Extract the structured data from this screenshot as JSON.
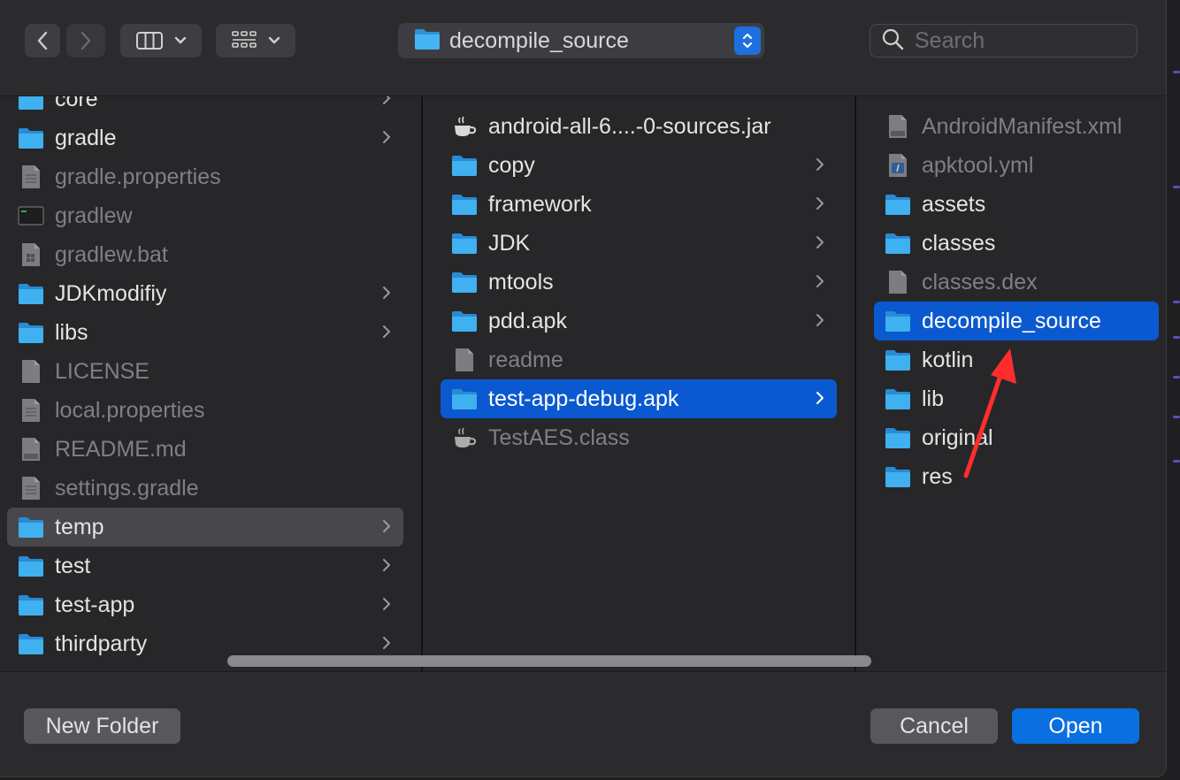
{
  "toolbar": {
    "back_icon": "chevron-left-icon",
    "forward_icon": "chevron-right-icon",
    "view_mode_icon": "columns-view-icon",
    "group_icon": "grid-view-icon",
    "path_label": "decompile_source",
    "search_placeholder": "Search"
  },
  "columns": [
    {
      "items": [
        {
          "label": "core",
          "kind": "folder",
          "dim": false,
          "chevron": true,
          "selected": ""
        },
        {
          "label": "gradle",
          "kind": "folder",
          "dim": false,
          "chevron": true,
          "selected": ""
        },
        {
          "label": "gradle.properties",
          "kind": "doc",
          "dim": true,
          "chevron": false,
          "selected": ""
        },
        {
          "label": "gradlew",
          "kind": "exec",
          "dim": true,
          "chevron": false,
          "selected": ""
        },
        {
          "label": "gradlew.bat",
          "kind": "bat",
          "dim": true,
          "chevron": false,
          "selected": ""
        },
        {
          "label": "JDKmodifiy",
          "kind": "folder",
          "dim": false,
          "chevron": true,
          "selected": ""
        },
        {
          "label": "libs",
          "kind": "folder",
          "dim": false,
          "chevron": true,
          "selected": ""
        },
        {
          "label": "LICENSE",
          "kind": "blank",
          "dim": true,
          "chevron": false,
          "selected": ""
        },
        {
          "label": "local.properties",
          "kind": "doc",
          "dim": true,
          "chevron": false,
          "selected": ""
        },
        {
          "label": "README.md",
          "kind": "md",
          "dim": true,
          "chevron": false,
          "selected": ""
        },
        {
          "label": "settings.gradle",
          "kind": "doc",
          "dim": true,
          "chevron": false,
          "selected": ""
        },
        {
          "label": "temp",
          "kind": "folder",
          "dim": false,
          "chevron": true,
          "selected": "gray"
        },
        {
          "label": "test",
          "kind": "folder",
          "dim": false,
          "chevron": true,
          "selected": ""
        },
        {
          "label": "test-app",
          "kind": "folder",
          "dim": false,
          "chevron": true,
          "selected": ""
        },
        {
          "label": "thirdparty",
          "kind": "folder",
          "dim": false,
          "chevron": true,
          "selected": ""
        }
      ]
    },
    {
      "items": [
        {
          "label": "android-all-6....-0-sources.jar",
          "kind": "jar",
          "dim": false,
          "chevron": false,
          "selected": ""
        },
        {
          "label": "copy",
          "kind": "folder",
          "dim": false,
          "chevron": true,
          "selected": ""
        },
        {
          "label": "framework",
          "kind": "folder",
          "dim": false,
          "chevron": true,
          "selected": ""
        },
        {
          "label": "JDK",
          "kind": "folder",
          "dim": false,
          "chevron": true,
          "selected": ""
        },
        {
          "label": "mtools",
          "kind": "folder",
          "dim": false,
          "chevron": true,
          "selected": ""
        },
        {
          "label": "pdd.apk",
          "kind": "folder",
          "dim": false,
          "chevron": true,
          "selected": ""
        },
        {
          "label": "readme",
          "kind": "blank",
          "dim": true,
          "chevron": false,
          "selected": ""
        },
        {
          "label": "test-app-debug.apk",
          "kind": "folder",
          "dim": false,
          "chevron": true,
          "selected": "blue"
        },
        {
          "label": "TestAES.class",
          "kind": "jar",
          "dim": true,
          "chevron": false,
          "selected": ""
        }
      ]
    },
    {
      "items": [
        {
          "label": "AndroidManifest.xml",
          "kind": "xml",
          "dim": true,
          "chevron": false,
          "selected": ""
        },
        {
          "label": "apktool.yml",
          "kind": "yml",
          "dim": true,
          "chevron": false,
          "selected": ""
        },
        {
          "label": "assets",
          "kind": "folder",
          "dim": false,
          "chevron": false,
          "selected": ""
        },
        {
          "label": "classes",
          "kind": "folder",
          "dim": false,
          "chevron": false,
          "selected": ""
        },
        {
          "label": "classes.dex",
          "kind": "blank",
          "dim": true,
          "chevron": false,
          "selected": ""
        },
        {
          "label": "decompile_source",
          "kind": "folder",
          "dim": false,
          "chevron": false,
          "selected": "blue"
        },
        {
          "label": "kotlin",
          "kind": "folder",
          "dim": false,
          "chevron": false,
          "selected": ""
        },
        {
          "label": "lib",
          "kind": "folder",
          "dim": false,
          "chevron": false,
          "selected": ""
        },
        {
          "label": "original",
          "kind": "folder",
          "dim": false,
          "chevron": false,
          "selected": ""
        },
        {
          "label": "res",
          "kind": "folder",
          "dim": false,
          "chevron": false,
          "selected": ""
        }
      ]
    }
  ],
  "footer": {
    "new_folder_label": "New Folder",
    "cancel_label": "Cancel",
    "open_label": "Open"
  },
  "colors": {
    "accent": "#0a6fe0",
    "selection_blue": "#0b59d0",
    "folder_blue": "#35a8ef",
    "annotation_red": "#ff2d2d"
  }
}
